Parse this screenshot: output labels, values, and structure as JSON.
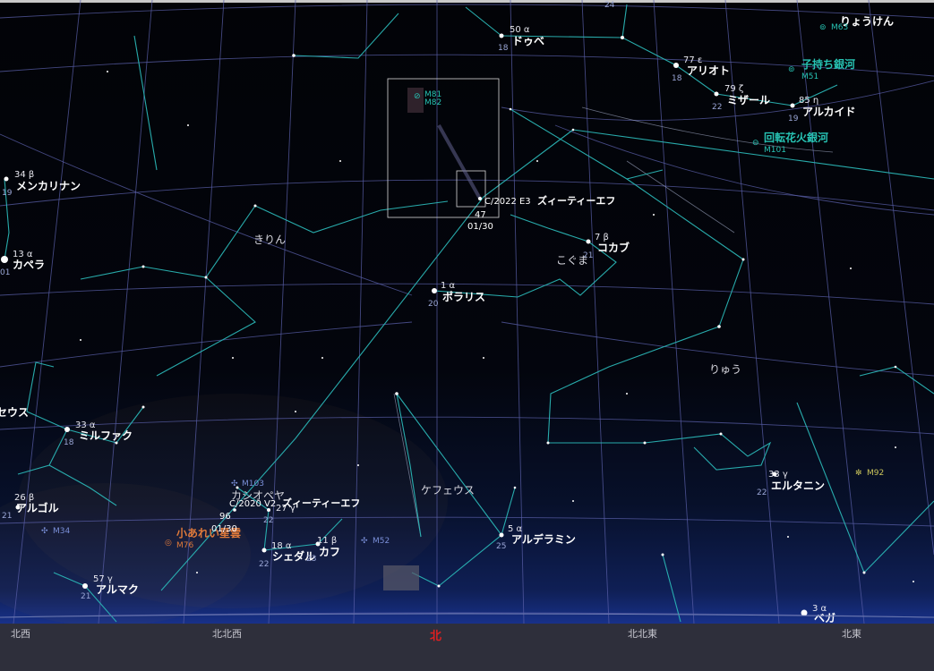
{
  "stars": [
    {
      "id": "dubhe",
      "num": "50 α",
      "name": "ドゥベ",
      "mag": "18"
    },
    {
      "id": "alioth",
      "num": "77 ε",
      "name": "アリオト",
      "mag": "18"
    },
    {
      "id": "mizar",
      "num": "79 ζ",
      "name": "ミザール",
      "mag": "22"
    },
    {
      "id": "alkaid",
      "num": "85 η",
      "name": "アルカイド",
      "mag": "19"
    },
    {
      "id": "menkalinan",
      "num": "34 β",
      "name": "メンカリナン",
      "mag": "19"
    },
    {
      "id": "capella",
      "num": "13 α",
      "name": "カペラ",
      "mag": "01"
    },
    {
      "id": "kochab",
      "num": "7 β",
      "name": "コカブ",
      "mag": "21"
    },
    {
      "id": "polaris",
      "num": "1 α",
      "name": "ポラリス",
      "mag": "20"
    },
    {
      "id": "mirfak",
      "num": "33 α",
      "name": "ミルファク",
      "mag": "18"
    },
    {
      "id": "algol",
      "num": "26 β",
      "name": "アルゴル",
      "mag": "21"
    },
    {
      "id": "almach",
      "num": "57 γ",
      "name": "アルマク",
      "mag": "21"
    },
    {
      "id": "schedar",
      "num": "18 α",
      "name": "シェダル",
      "mag": "22"
    },
    {
      "id": "caph",
      "num": "11 β",
      "name": "カフ",
      "mag": "23"
    },
    {
      "id": "navi",
      "num": "27 γ",
      "name": "",
      "mag": "22"
    },
    {
      "id": "alderamin",
      "num": "5 α",
      "name": "アルデラミン",
      "mag": "25"
    },
    {
      "id": "eltanin",
      "num": "33 γ",
      "name": "エルタニン",
      "mag": "22"
    },
    {
      "id": "vega",
      "num": "3 α",
      "name": "ベガ",
      "mag": ""
    },
    {
      "id": "top",
      "num": "24",
      "name": "",
      "mag": ""
    }
  ],
  "constellations": {
    "camelopardalis": "きりん",
    "ursa_minor": "こぐま",
    "draco": "りゅう",
    "cepheus": "ケフェウス",
    "cassiopeia": "カシオペヤ",
    "perseus": "ペルセウス",
    "canes_venatici": "りょうけん"
  },
  "deep_sky": [
    {
      "id": "m81",
      "name": "",
      "code": "M81"
    },
    {
      "id": "m82",
      "name": "",
      "code": "M82"
    },
    {
      "id": "m51",
      "name": "子持ち銀河",
      "code": "M51"
    },
    {
      "id": "m101",
      "name": "回転花火銀河",
      "code": "M101"
    },
    {
      "id": "m63",
      "name": "",
      "code": "M63"
    },
    {
      "id": "m103",
      "name": "",
      "code": "M103"
    },
    {
      "id": "m76",
      "name": "小あれい星雲",
      "code": "M76"
    },
    {
      "id": "m34",
      "name": "",
      "code": "M34"
    },
    {
      "id": "m52",
      "name": "",
      "code": "M52"
    },
    {
      "id": "m92",
      "name": "",
      "code": "M92"
    }
  ],
  "comets": [
    {
      "id": "c2022e3",
      "designation": "C/2022 E3",
      "name": "ズィーティーエフ",
      "mag": "47",
      "date": "01/30"
    },
    {
      "id": "c2020v2",
      "designation": "C/2020 V2",
      "name": "ズィーティーエフ",
      "mag": "96",
      "date": "01/30"
    }
  ],
  "directions": [
    "北西",
    "北北西",
    "北",
    "北北東",
    "北東"
  ],
  "colors": {
    "constellation_lines": "#2ab4b4",
    "grid": "#5a5fa8",
    "north": "#e02020",
    "deep_sky": "#27c3b3",
    "nebula": "#e07a3a"
  }
}
